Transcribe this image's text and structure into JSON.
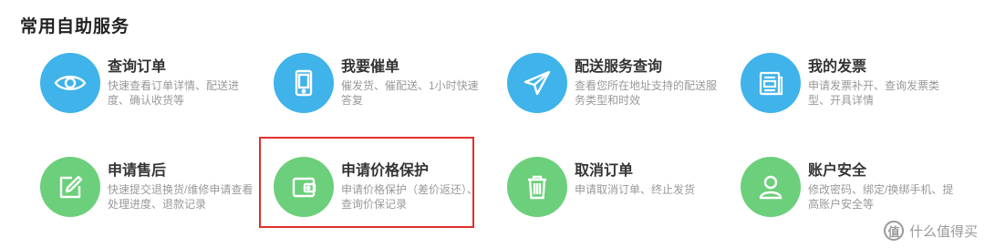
{
  "section": {
    "title": "常用自助服务"
  },
  "colors": {
    "blue": "#3fb3ea",
    "green": "#6ccf7b",
    "highlight": "#e0302c"
  },
  "services": [
    {
      "name": "查询订单",
      "desc": "快速查看订单详情、配送进度、确认收货等",
      "icon": "eye-icon"
    },
    {
      "name": "我要催单",
      "desc": "催发货、催配送、1小时快速答复",
      "icon": "phone-icon"
    },
    {
      "name": "配送服务查询",
      "desc": "查看您所在地址支持的配送服务类型和时效",
      "icon": "paper-plane-icon"
    },
    {
      "name": "我的发票",
      "desc": "申请发票补开、查询发票类型、开具详情",
      "icon": "invoice-icon"
    },
    {
      "name": "申请售后",
      "desc": "快速提交退换货/维修申请查看处理进度、退款记录",
      "icon": "edit-icon"
    },
    {
      "name": "申请价格保护",
      "desc": "申请价格保护（差价返还）、查询价保记录",
      "icon": "wallet-icon"
    },
    {
      "name": "取消订单",
      "desc": "申请取消订单、终止发货",
      "icon": "trash-icon"
    },
    {
      "name": "账户安全",
      "desc": "修改密码、绑定/换绑手机、提高账户安全等",
      "icon": "user-icon"
    }
  ],
  "watermark": {
    "logo": "值",
    "text": "什么值得买"
  }
}
